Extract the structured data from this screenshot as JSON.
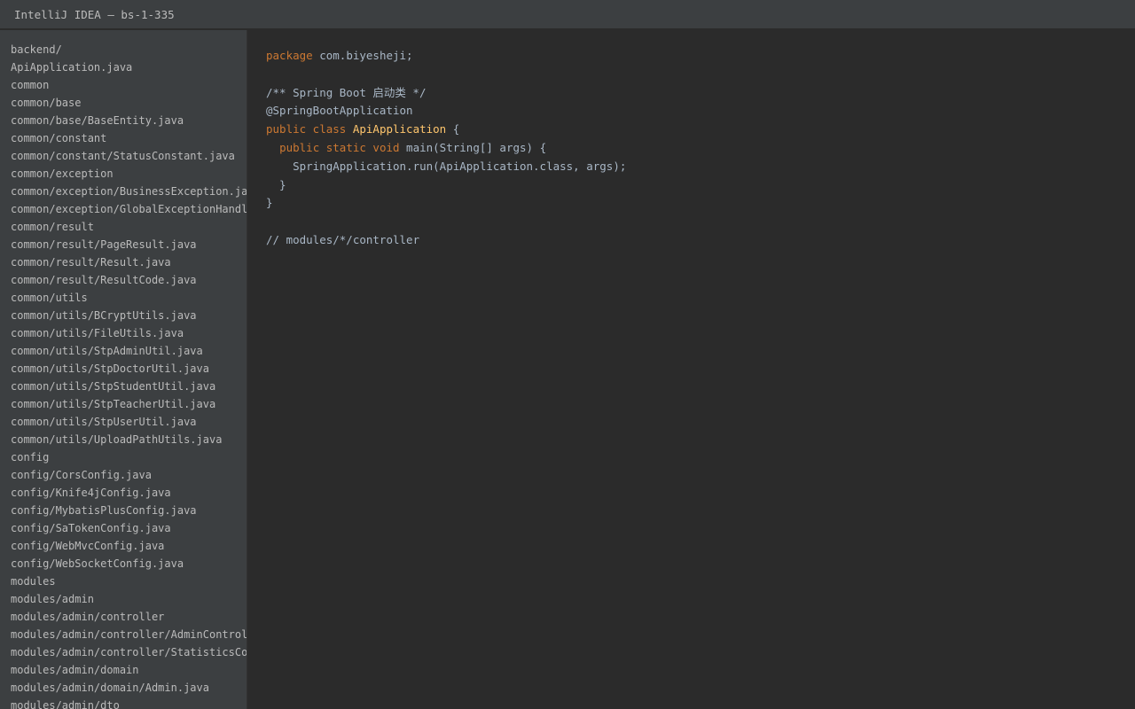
{
  "window": {
    "title": "IntelliJ IDEA — bs-1-335"
  },
  "project_tree": {
    "items": [
      "backend/",
      "ApiApplication.java",
      "common",
      "common/base",
      "common/base/BaseEntity.java",
      "common/constant",
      "common/constant/StatusConstant.java",
      "common/exception",
      "common/exception/BusinessException.java",
      "common/exception/GlobalExceptionHandler.java",
      "common/result",
      "common/result/PageResult.java",
      "common/result/Result.java",
      "common/result/ResultCode.java",
      "common/utils",
      "common/utils/BCryptUtils.java",
      "common/utils/FileUtils.java",
      "common/utils/StpAdminUtil.java",
      "common/utils/StpDoctorUtil.java",
      "common/utils/StpStudentUtil.java",
      "common/utils/StpTeacherUtil.java",
      "common/utils/StpUserUtil.java",
      "common/utils/UploadPathUtils.java",
      "config",
      "config/CorsConfig.java",
      "config/Knife4jConfig.java",
      "config/MybatisPlusConfig.java",
      "config/SaTokenConfig.java",
      "config/WebMvcConfig.java",
      "config/WebSocketConfig.java",
      "modules",
      "modules/admin",
      "modules/admin/controller",
      "modules/admin/controller/AdminController.java",
      "modules/admin/controller/StatisticsController.java",
      "modules/admin/domain",
      "modules/admin/domain/Admin.java",
      "modules/admin/dto"
    ]
  },
  "editor": {
    "line1": {
      "kw": "package",
      "rest": " com.biyesheji;"
    },
    "line2": "",
    "line3": "/** Spring Boot 启动类 */",
    "line4": "@SpringBootApplication",
    "line5": {
      "kw": "public class",
      "sp": " ",
      "cls": "ApiApplication",
      "rest": " {"
    },
    "line6": {
      "indent": "  ",
      "kw": "public static void",
      "rest": " main(String[] args) {"
    },
    "line7": "    SpringApplication.run(ApiApplication.class, args);",
    "line8": "  }",
    "line9": "}",
    "line10": "",
    "line11": "// modules/*/controller"
  },
  "colors": {
    "keyword": "#cc7832",
    "comment": "#808080",
    "class_name": "#ffc66d",
    "text": "#a9b7c6",
    "sidebar_bg": "#3c3f41",
    "editor_bg": "#2b2b2b"
  }
}
